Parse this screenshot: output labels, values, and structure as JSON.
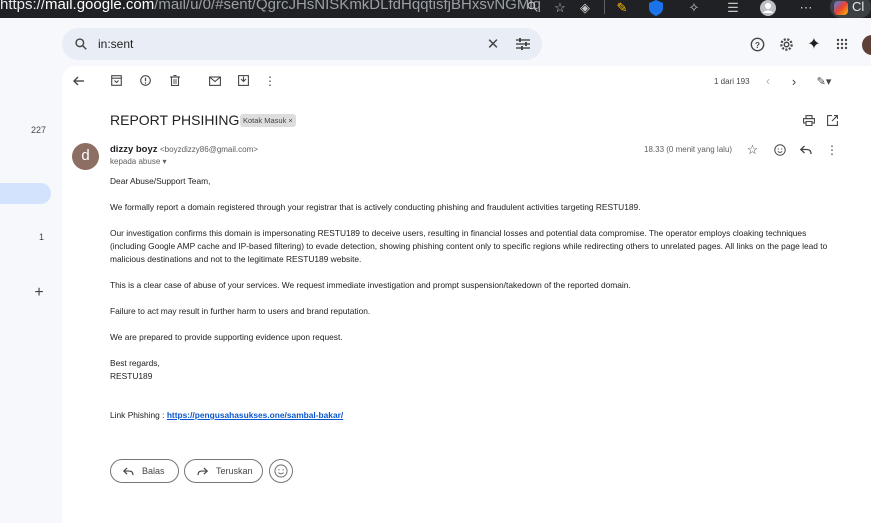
{
  "browser": {
    "url_prefix": "https://",
    "url_host": "mail.google.com",
    "url_path": "/mail/u/0/#sent/QgrcJHsNISKmkDLfdHqqtisfjBHxsvNGMlq",
    "tab_fragment": "Cl"
  },
  "search": {
    "query": "in:sent"
  },
  "rail": {
    "count_inbox": "227",
    "count_other": "1"
  },
  "toolbar": {
    "pager": "1 dari 193"
  },
  "email": {
    "subject": "REPORT PHSIHING",
    "label": "Kotak Masuk ×",
    "avatar_letter": "d",
    "sender_name": "dizzy boyz",
    "sender_email": "<boyzdizzy86@gmail.com>",
    "to": "kepada abuse ▾",
    "time": "18.33 (0 menit yang lalu)",
    "body": {
      "greeting": "Dear Abuse/Support Team,",
      "p1": "We formally report a domain registered through your registrar that is actively conducting phishing and fraudulent activities targeting RESTU189.",
      "p2": "Our investigation confirms this domain is impersonating RESTU189 to deceive users, resulting in financial losses and potential data compromise. The operator employs cloaking techniques (including Google AMP cache and IP-based filtering) to evade detection, showing phishing content only to specific regions while redirecting others to unrelated pages. All links on the page lead to malicious destinations and not to the legitimate RESTU189 website.",
      "p3": "This is a clear case of abuse of your services. We request immediate investigation and prompt suspension/takedown of the reported domain.",
      "p4": "Failure to act may result in further harm to users and brand reputation.",
      "p5": "We are prepared to provide supporting evidence upon request.",
      "closing": "Best regards,",
      "signature": "RESTU189",
      "link_label": "Link Phishing : ",
      "link_url": "https://pengusahasukses.one/sambal-bakar/"
    }
  },
  "actions": {
    "reply": "Balas",
    "forward": "Teruskan"
  }
}
